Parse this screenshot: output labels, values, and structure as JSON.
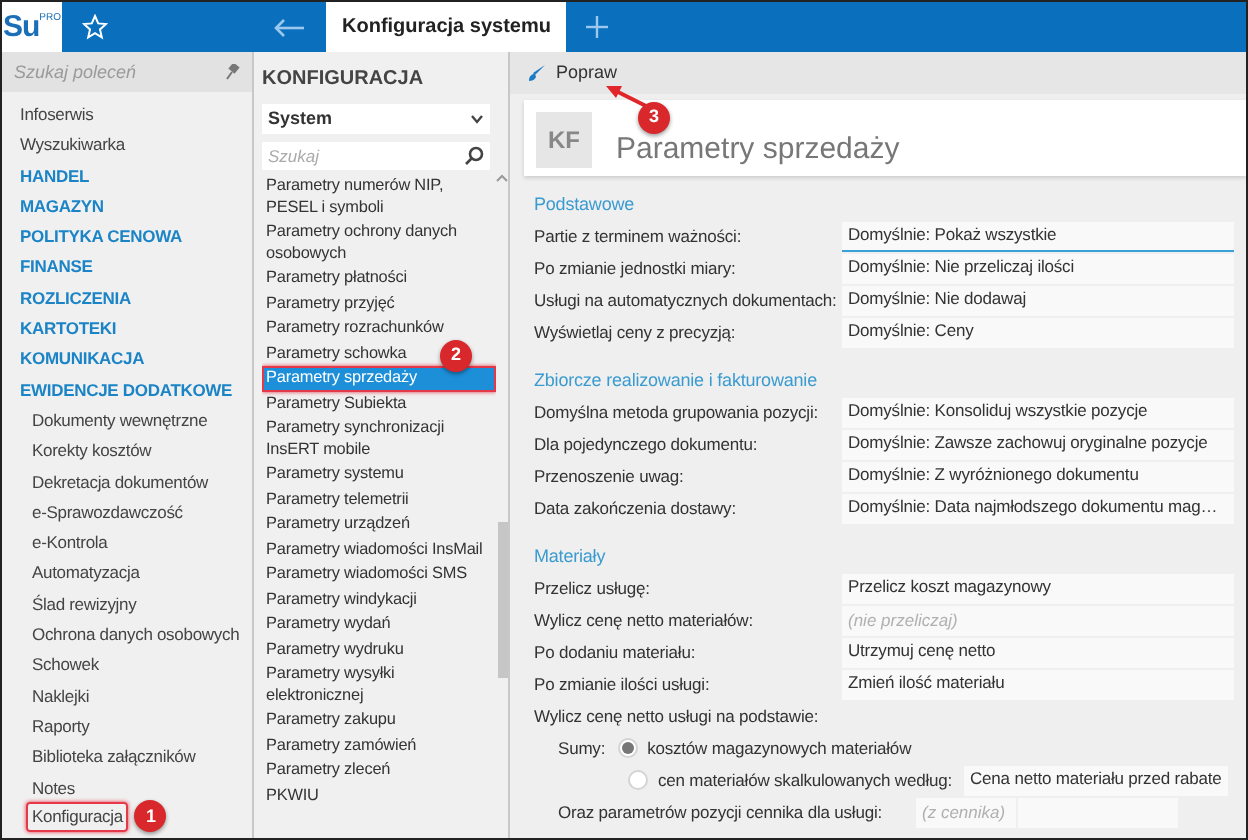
{
  "app": {
    "logo": "Su",
    "logo_superscript": "PRO",
    "tab_title": "Konfiguracja systemu"
  },
  "command_search": {
    "placeholder": "Szukaj poleceń"
  },
  "nav": [
    {
      "label": "Infoserwis",
      "kind": "link",
      "highlighted": false
    },
    {
      "label": "Wyszukiwarka",
      "kind": "link",
      "highlighted": false
    },
    {
      "label": "HANDEL",
      "kind": "category",
      "highlighted": false
    },
    {
      "label": "MAGAZYN",
      "kind": "category",
      "highlighted": false
    },
    {
      "label": "POLITYKA CENOWA",
      "kind": "category",
      "highlighted": false
    },
    {
      "label": "FINANSE",
      "kind": "category",
      "highlighted": false
    },
    {
      "label": "ROZLICZENIA",
      "kind": "category",
      "highlighted": false
    },
    {
      "label": "KARTOTEKI",
      "kind": "category",
      "highlighted": false
    },
    {
      "label": "KOMUNIKACJA",
      "kind": "category",
      "highlighted": false
    },
    {
      "label": "EWIDENCJE DODATKOWE",
      "kind": "category",
      "highlighted": false,
      "children": [
        {
          "label": "Dokumenty wewnętrzne",
          "kind": "link",
          "highlighted": false
        },
        {
          "label": "Korekty kosztów",
          "kind": "link",
          "highlighted": false
        },
        {
          "label": "Dekretacja dokumentów",
          "kind": "link",
          "highlighted": false
        },
        {
          "label": "e-Sprawozdawczość",
          "kind": "link",
          "highlighted": false
        },
        {
          "label": "e-Kontrola",
          "kind": "link",
          "highlighted": false
        },
        {
          "label": "Automatyzacja",
          "kind": "link",
          "highlighted": false
        },
        {
          "label": "Ślad rewizyjny",
          "kind": "link",
          "highlighted": false
        },
        {
          "label": "Ochrona danych osobowych",
          "kind": "link",
          "highlighted": false
        },
        {
          "label": "Schowek",
          "kind": "link",
          "highlighted": false
        },
        {
          "label": "Naklejki",
          "kind": "link",
          "highlighted": false
        },
        {
          "label": "Raporty",
          "kind": "link",
          "highlighted": false
        },
        {
          "label": "Biblioteka załączników",
          "kind": "link",
          "highlighted": false
        },
        {
          "label": "Notes",
          "kind": "link",
          "highlighted": false
        },
        {
          "label": "Konfiguracja",
          "kind": "link",
          "highlighted": true,
          "callout": "1"
        }
      ]
    }
  ],
  "config_panel": {
    "title": "KONFIGURACJA",
    "dropdown_value": "System",
    "search_placeholder": "Szukaj",
    "items": [
      {
        "label": "Parametry numerów NIP, PESEL i symboli",
        "selected": false,
        "highlighted": false
      },
      {
        "label": "Parametry ochrony danych osobowych",
        "selected": false,
        "highlighted": false
      },
      {
        "label": "Parametry płatności",
        "selected": false,
        "highlighted": false
      },
      {
        "label": "Parametry przyjęć",
        "selected": false,
        "highlighted": false
      },
      {
        "label": "Parametry rozrachunków",
        "selected": false,
        "highlighted": false
      },
      {
        "label": "Parametry schowka",
        "selected": false,
        "highlighted": false
      },
      {
        "label": "Parametry sprzedaży",
        "selected": true,
        "highlighted": true,
        "callout": "2"
      },
      {
        "label": "Parametry Subiekta",
        "selected": false,
        "highlighted": false
      },
      {
        "label": "Parametry synchronizacji InsERT mobile",
        "selected": false,
        "highlighted": false
      },
      {
        "label": "Parametry systemu",
        "selected": false,
        "highlighted": false
      },
      {
        "label": "Parametry telemetrii",
        "selected": false,
        "highlighted": false
      },
      {
        "label": "Parametry urządzeń",
        "selected": false,
        "highlighted": false
      },
      {
        "label": "Parametry wiadomości InsMail",
        "selected": false,
        "highlighted": false
      },
      {
        "label": "Parametry wiadomości SMS",
        "selected": false,
        "highlighted": false
      },
      {
        "label": "Parametry windykacji",
        "selected": false,
        "highlighted": false
      },
      {
        "label": "Parametry wydań",
        "selected": false,
        "highlighted": false
      },
      {
        "label": "Parametry wydruku",
        "selected": false,
        "highlighted": false
      },
      {
        "label": "Parametry wysyłki elektronicznej",
        "selected": false,
        "highlighted": false
      },
      {
        "label": "Parametry zakupu",
        "selected": false,
        "highlighted": false
      },
      {
        "label": "Parametry zamówień",
        "selected": false,
        "highlighted": false
      },
      {
        "label": "Parametry zleceń",
        "selected": false,
        "highlighted": false
      },
      {
        "label": "PKWIU",
        "selected": false,
        "highlighted": false
      }
    ]
  },
  "toolbar": {
    "buttons": [
      {
        "label": "Popraw",
        "callout": "3"
      }
    ]
  },
  "header": {
    "initials": "KF",
    "title": "Parametry sprzedaży"
  },
  "sections": [
    {
      "title": "Podstawowe",
      "rows": [
        {
          "label": "Partie z terminem ważności:",
          "value": "Domyślnie: Pokaż wszystkie",
          "focused": true
        },
        {
          "label": "Po zmianie jednostki miary:",
          "value": "Domyślnie: Nie przeliczaj ilości",
          "focused": false
        },
        {
          "label": "Usługi na automatycznych dokumentach:",
          "value": "Domyślnie: Nie dodawaj",
          "focused": false
        },
        {
          "label": "Wyświetlaj ceny z precyzją:",
          "value": "Domyślnie: Ceny",
          "focused": false
        }
      ]
    },
    {
      "title": "Zbiorcze realizowanie i fakturowanie",
      "rows": [
        {
          "label": "Domyślna metoda grupowania pozycji:",
          "value": "Domyślnie: Konsoliduj wszystkie pozycje",
          "focused": false
        },
        {
          "label": "Dla pojedynczego dokumentu:",
          "value": "Domyślnie: Zawsze zachowuj oryginalne pozycje",
          "focused": false
        },
        {
          "label": "Przenoszenie uwag:",
          "value": "Domyślnie: Z wyróżnionego dokumentu",
          "focused": false
        },
        {
          "label": "Data zakończenia dostawy:",
          "value": "Domyślnie: Data najmłodszego dokumentu mag…",
          "focused": false
        }
      ]
    },
    {
      "title": "Materiały",
      "rows": [
        {
          "label": "Przelicz usługę:",
          "value": "Przelicz koszt magazynowy",
          "focused": false
        },
        {
          "label": "Wylicz cenę netto materiałów:",
          "placeholder": "(nie przeliczaj)",
          "focused": false
        },
        {
          "label": "Po dodaniu materiału:",
          "value": "Utrzymuj cenę netto",
          "focused": false
        },
        {
          "label": "Po zmianie ilości usługi:",
          "value": "Zmień ilość materiału",
          "focused": false
        }
      ]
    }
  ],
  "service_price": {
    "label": "Wylicz cenę netto usługi na podstawie:",
    "sums_label": "Sumy:",
    "options": [
      {
        "label": "kosztów magazynowych materiałów",
        "selected": true
      },
      {
        "label": "cen materiałów skalkulowanych według:",
        "selected": false,
        "value": "Cena netto materiału przed rabate"
      }
    ],
    "pricelist_label": "Oraz parametrów pozycji cennika dla usługi:",
    "pricelist_placeholder": "(z cennika)"
  }
}
